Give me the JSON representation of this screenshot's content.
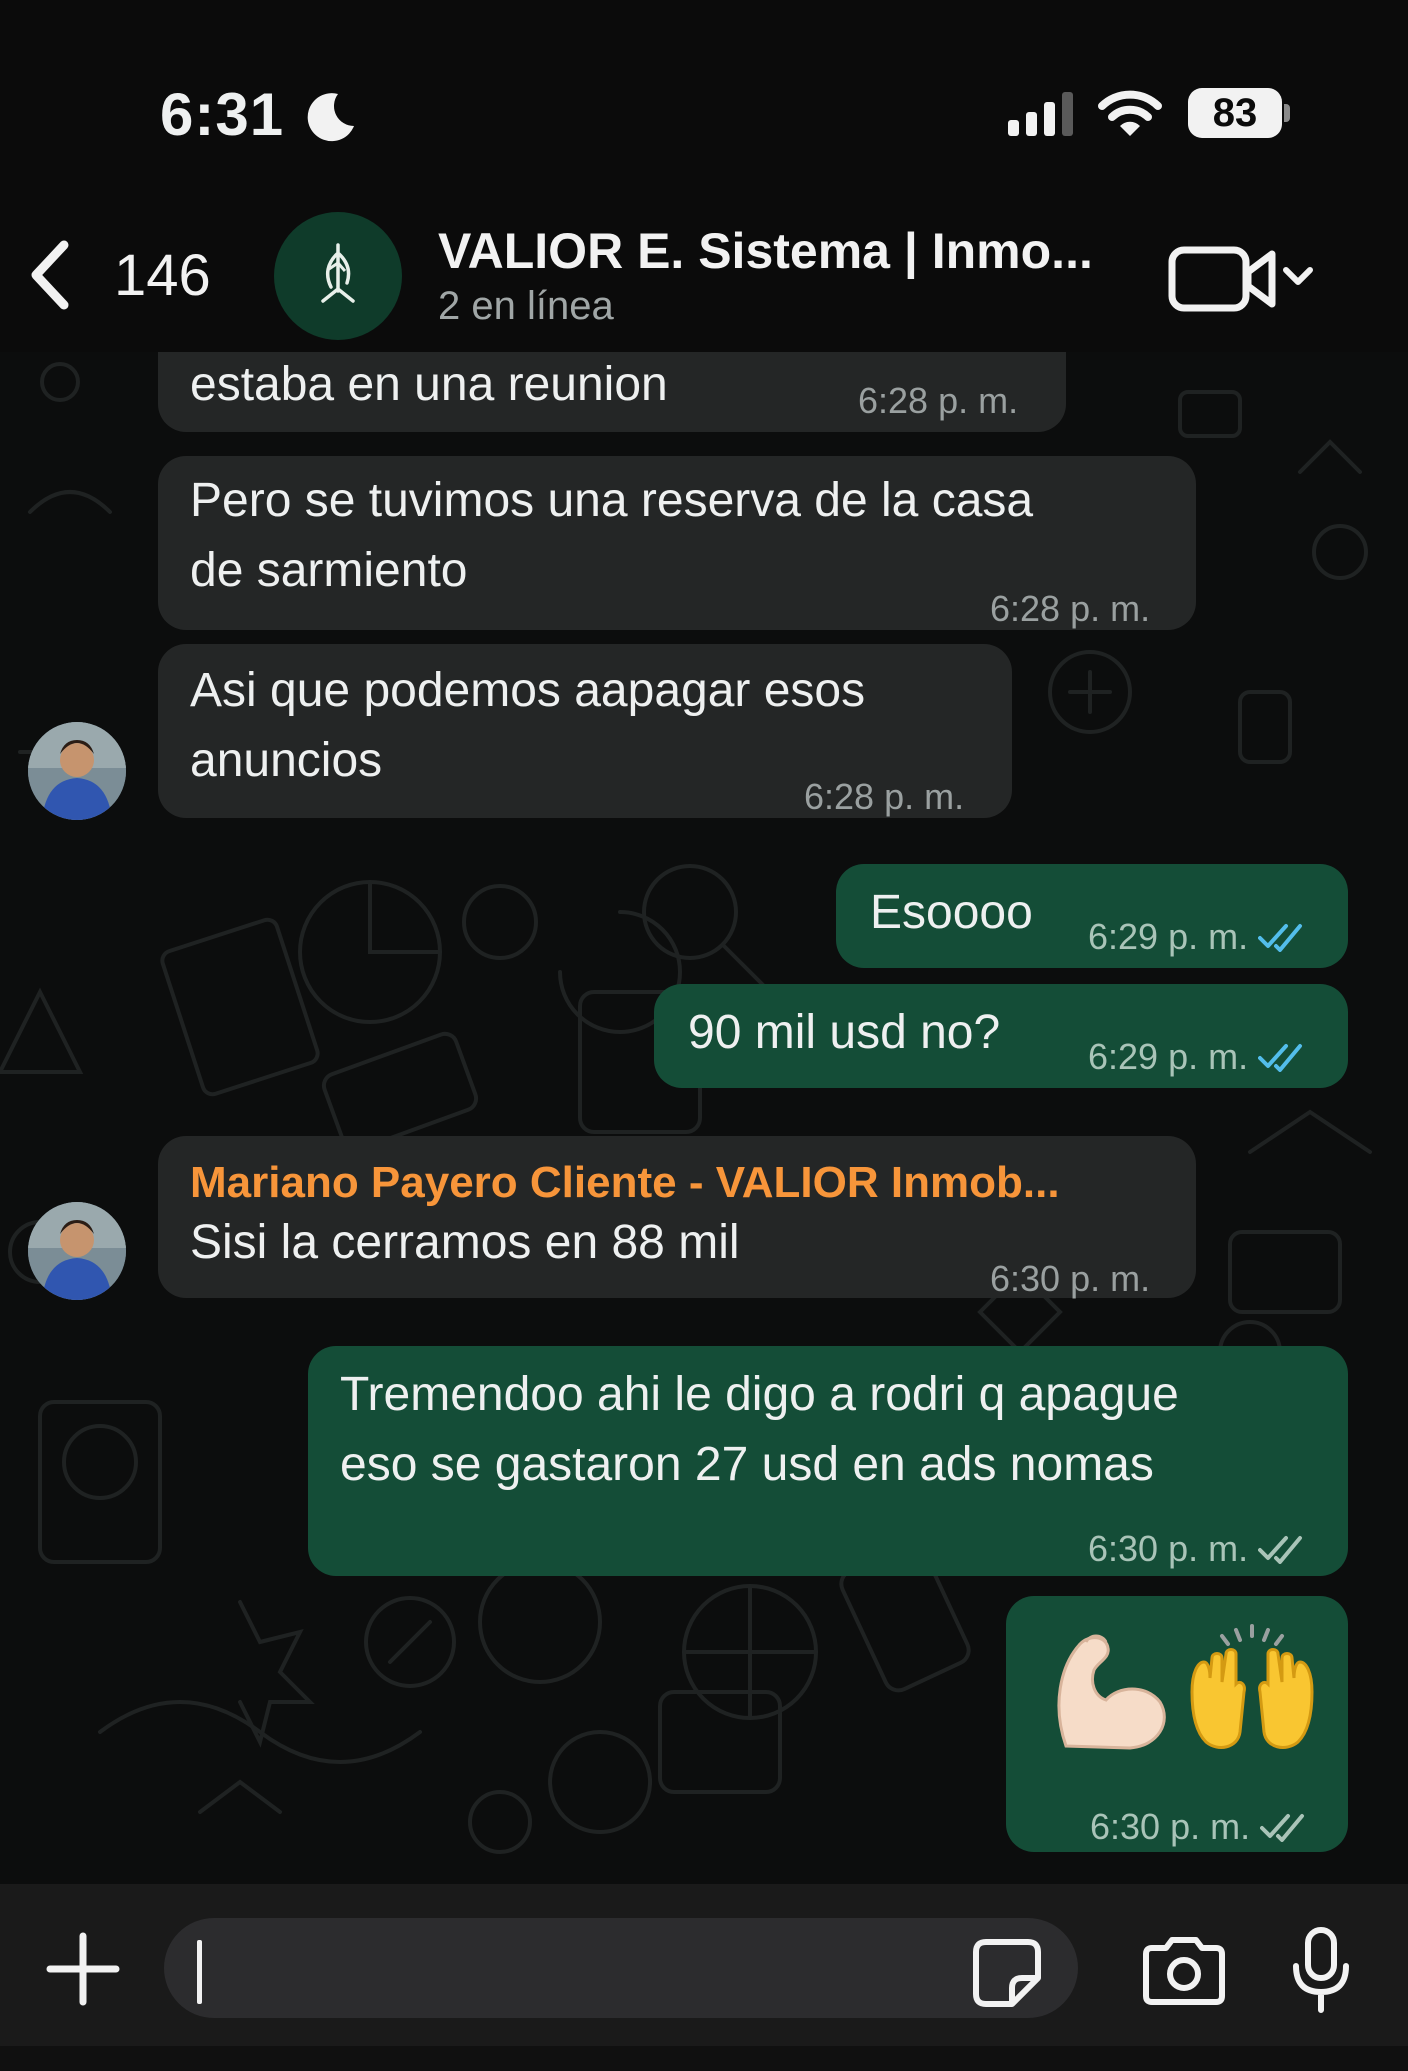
{
  "status_bar": {
    "time": "6:31",
    "battery": "83"
  },
  "header": {
    "back_count": "146",
    "title": "VALIOR E. Sistema | Inmo...",
    "subtitle": "2 en línea"
  },
  "messages": [
    {
      "direction": "incoming",
      "text_lines": [
        "estaba en una reunion"
      ],
      "time": "6:28 p. m."
    },
    {
      "direction": "incoming",
      "text_lines": [
        "Pero se tuvimos una reserva de la casa",
        "de sarmiento"
      ],
      "time": "6:28 p. m."
    },
    {
      "direction": "incoming",
      "text_lines": [
        "Asi que podemos aapagar esos",
        "anuncios"
      ],
      "time": "6:28 p. m."
    },
    {
      "direction": "outgoing",
      "text_lines": [
        "Esoooo"
      ],
      "time": "6:29 p. m.",
      "status": "read"
    },
    {
      "direction": "outgoing",
      "text_lines": [
        "90 mil usd no?"
      ],
      "time": "6:29 p. m.",
      "status": "read"
    },
    {
      "direction": "incoming",
      "sender": "Mariano Payero Cliente - VALIOR Inmob...",
      "text_lines": [
        "Sisi la cerramos en 88 mil"
      ],
      "time": "6:30 p. m."
    },
    {
      "direction": "outgoing",
      "text_lines": [
        "Tremendoo ahi le digo a rodri q apague",
        "eso se gastaron 27 usd en ads nomas"
      ],
      "time": "6:30 p. m.",
      "status": "delivered"
    },
    {
      "direction": "outgoing",
      "emoji": [
        "flexed-biceps",
        "raising-hands"
      ],
      "time": "6:30 p. m.",
      "status": "delivered"
    }
  ],
  "input": {
    "placeholder": ""
  },
  "icons": {
    "back": "chevron-left-icon",
    "video": "video-camera-icon",
    "plus": "plus-icon",
    "sticker": "sticker-icon",
    "camera": "camera-icon",
    "mic": "microphone-icon",
    "read_ticks": "double-check-blue-icon",
    "delivered_ticks": "double-check-grey-icon"
  },
  "colors": {
    "incoming_bubble": "#242626",
    "outgoing_bubble": "#144d37",
    "sender_name": "#f7953a",
    "read_tick": "#53bdeb",
    "background": "#0c0d0d"
  }
}
